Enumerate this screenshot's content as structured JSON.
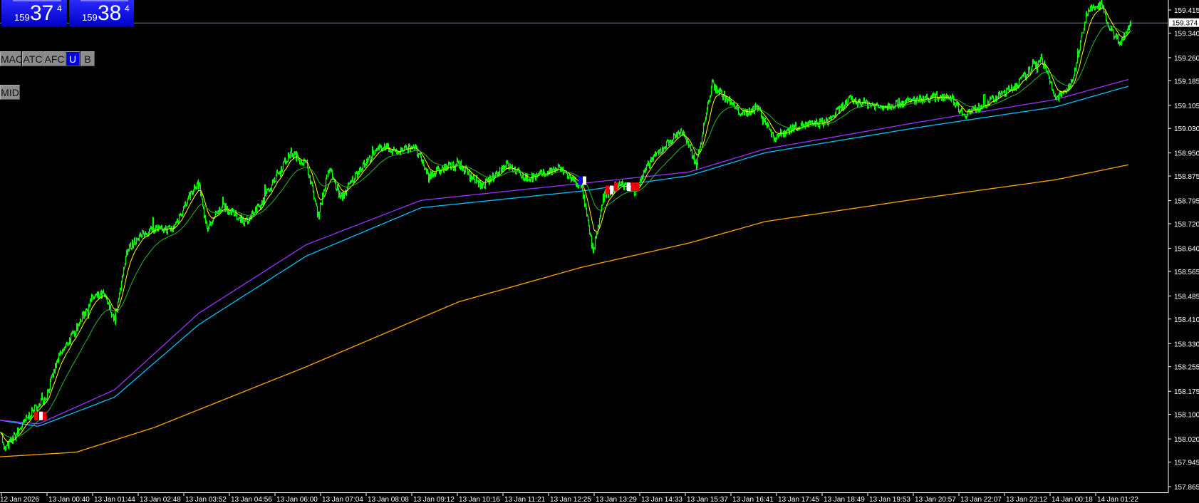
{
  "quotes": {
    "bid": {
      "prefix": "159",
      "big": "37",
      "sup": "4"
    },
    "ask": {
      "prefix": "159",
      "big": "38",
      "sup": "4"
    }
  },
  "buttons": [
    {
      "label": "MAC",
      "active": false
    },
    {
      "label": "ATC",
      "active": false
    },
    {
      "label": "AFC",
      "active": false
    },
    {
      "label": "U",
      "active": true
    },
    {
      "label": "B",
      "active": false
    }
  ],
  "mid_button": "MID",
  "colors": {
    "background": "#000000",
    "price": "#00ff00",
    "ma_fast": "#ffff00",
    "ma_mid": "#22bb22",
    "ma_purple": "#9933ff",
    "ma_cyan": "#00bfff",
    "ma_orange": "#ffa500",
    "axis": "#ffffff",
    "current_line": "#778899"
  },
  "chart_data": {
    "type": "line",
    "title": "",
    "xlabel": "",
    "ylabel": "",
    "x_unit": "minutes from chart start",
    "ylim": [
      157.865,
      159.415
    ],
    "current_price": "159.374",
    "y_ticks": [
      "159.415",
      "159.340",
      "159.260",
      "159.185",
      "159.105",
      "159.030",
      "158.950",
      "158.875",
      "158.795",
      "158.720",
      "158.640",
      "158.565",
      "158.485",
      "158.410",
      "158.330",
      "158.255",
      "158.175",
      "158.100",
      "158.020",
      "157.945",
      "157.865"
    ],
    "x_ticks": [
      "12 Jan 2026",
      "13 Jan 00:40",
      "13 Jan 01:44",
      "13 Jan 02:48",
      "13 Jan 03:52",
      "13 Jan 04:56",
      "13 Jan 06:00",
      "13 Jan 07:04",
      "13 Jan 08:08",
      "13 Jan 09:12",
      "13 Jan 10:16",
      "13 Jan 11:21",
      "13 Jan 12:25",
      "13 Jan 13:29",
      "13 Jan 14:33",
      "13 Jan 15:37",
      "13 Jan 16:41",
      "13 Jan 17:45",
      "13 Jan 18:49",
      "13 Jan 19:53",
      "13 Jan 20:57",
      "13 Jan 22:07",
      "13 Jan 23:12",
      "14 Jan 00:18",
      "14 Jan 01:22"
    ],
    "series": [
      {
        "name": "price",
        "x": [
          0,
          5,
          21,
          43,
          64,
          81,
          107,
          129,
          145,
          161,
          177,
          193,
          215,
          242,
          269,
          279,
          290,
          311,
          344,
          365,
          387,
          408,
          430,
          446,
          462,
          478,
          505,
          537,
          558,
          580,
          601,
          623,
          644,
          677,
          709,
          741,
          784,
          816,
          832,
          848,
          870,
          891,
          913,
          934,
          956,
          977,
          999,
          1020,
          1042,
          1063,
          1085,
          1117,
          1160,
          1192,
          1235,
          1289,
          1332,
          1353,
          1385,
          1428,
          1461,
          1482,
          1504,
          1525,
          1547,
          1557,
          1573,
          1587
        ],
        "y": [
          158.056,
          157.982,
          158.031,
          158.106,
          158.156,
          158.28,
          158.379,
          158.479,
          158.491,
          158.404,
          158.628,
          158.677,
          158.702,
          158.702,
          158.826,
          158.851,
          158.702,
          158.777,
          158.727,
          158.777,
          158.876,
          158.951,
          158.913,
          158.752,
          158.901,
          158.801,
          158.901,
          158.975,
          158.951,
          158.975,
          158.876,
          158.901,
          158.913,
          158.839,
          158.913,
          158.864,
          158.901,
          158.839,
          158.628,
          158.814,
          158.851,
          158.826,
          158.926,
          158.975,
          159.025,
          158.913,
          159.174,
          159.124,
          159.075,
          159.1,
          159.0,
          159.037,
          159.05,
          159.124,
          159.1,
          159.124,
          159.137,
          159.075,
          159.112,
          159.174,
          159.261,
          159.124,
          159.174,
          159.41,
          159.435,
          159.348,
          159.311,
          159.373
        ]
      },
      {
        "name": "ma_purple",
        "x": [
          0,
          54,
          161,
          279,
          430,
          591,
          816,
          967,
          1074,
          1289,
          1482,
          1587
        ],
        "y": [
          158.081,
          158.069,
          158.18,
          158.429,
          158.652,
          158.796,
          158.851,
          158.888,
          158.963,
          159.05,
          159.124,
          159.191
        ]
      },
      {
        "name": "ma_cyan",
        "x": [
          0,
          54,
          161,
          279,
          430,
          591,
          816,
          967,
          1074,
          1289,
          1482,
          1587
        ],
        "y": [
          158.081,
          158.061,
          158.156,
          158.392,
          158.615,
          158.772,
          158.826,
          158.876,
          158.951,
          159.033,
          159.1,
          159.169
        ]
      },
      {
        "name": "ma_orange",
        "x": [
          0,
          107,
          215,
          430,
          644,
          816,
          967,
          1074,
          1289,
          1482,
          1587
        ],
        "y": [
          157.962,
          157.977,
          158.056,
          158.255,
          158.466,
          158.578,
          158.657,
          158.727,
          158.801,
          158.863,
          158.913
        ]
      }
    ]
  }
}
